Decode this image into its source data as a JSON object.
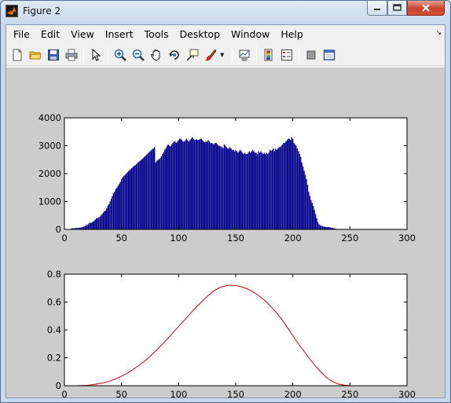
{
  "window": {
    "title": "Figure 2",
    "controls": {
      "minimize": "minimize",
      "maximize": "maximize",
      "close": "close"
    }
  },
  "menu": {
    "items": [
      "File",
      "Edit",
      "View",
      "Insert",
      "Tools",
      "Desktop",
      "Window",
      "Help"
    ]
  },
  "toolbar": {
    "buttons": [
      "new-figure",
      "open-file",
      "save-figure",
      "print-figure",
      "edit-plot",
      "zoom-in",
      "zoom-out",
      "pan",
      "rotate-3d",
      "data-cursor",
      "brush",
      "link-plot",
      "colorbar",
      "legend",
      "hide-plot-tools",
      "show-plot-tools"
    ]
  },
  "colors": {
    "histogram": "#00008b",
    "curve": "#cc0000",
    "axes_bg": "#ffffff",
    "figure_bg": "#cccccc"
  },
  "chart_data": [
    {
      "type": "bar",
      "title": "",
      "xlabel": "",
      "ylabel": "",
      "xlim": [
        0,
        300
      ],
      "ylim": [
        0,
        4000
      ],
      "xticks": [
        "0",
        "50",
        "100",
        "150",
        "200",
        "250",
        "300"
      ],
      "yticks": [
        "0",
        "1000",
        "2000",
        "3000",
        "4000"
      ],
      "bins_start": 0,
      "values": [
        0,
        0,
        0,
        0,
        0,
        10,
        30,
        40,
        40,
        40,
        50,
        50,
        50,
        60,
        60,
        70,
        80,
        100,
        120,
        150,
        160,
        190,
        230,
        240,
        240,
        280,
        300,
        350,
        400,
        410,
        430,
        450,
        500,
        550,
        600,
        650,
        680,
        750,
        850,
        900,
        1000,
        1100,
        1200,
        1300,
        1350,
        1450,
        1500,
        1560,
        1630,
        1700,
        1800,
        1860,
        1920,
        1950,
        2000,
        2040,
        2080,
        2120,
        2160,
        2200,
        2240,
        2280,
        2300,
        2340,
        2380,
        2420,
        2450,
        2480,
        2520,
        2560,
        2600,
        2640,
        2680,
        2720,
        2760,
        2800,
        2840,
        2880,
        2900,
        2950,
        2400,
        2460,
        2500,
        2520,
        2560,
        2620,
        2700,
        2780,
        2860,
        2920,
        3000,
        3050,
        3000,
        2980,
        3050,
        3100,
        3150,
        3150,
        3100,
        3150,
        3200,
        3250,
        3250,
        3200,
        3150,
        3150,
        3200,
        3250,
        3200,
        3150,
        3200,
        3250,
        3300,
        3250,
        3200,
        3220,
        3230,
        3200,
        3210,
        3250,
        3250,
        3200,
        3150,
        3120,
        3150,
        3150,
        3200,
        3150,
        3100,
        3100,
        3080,
        3050,
        3100,
        3100,
        3050,
        3000,
        3000,
        2970,
        2950,
        2920,
        3050,
        3000,
        2950,
        2900,
        2900,
        2950,
        2900,
        2850,
        2850,
        2800,
        2850,
        2800,
        2750,
        2800,
        2850,
        2800,
        2750,
        2700,
        2750,
        2700,
        2700,
        2750,
        2800,
        2750,
        2800,
        2850,
        2800,
        2750,
        2750,
        2700,
        2800,
        2750,
        2800,
        2750,
        2700,
        2750,
        2700,
        2750,
        2700,
        2750,
        2850,
        2820,
        2850,
        2900,
        2800,
        2900,
        2850,
        2900,
        2950,
        2950,
        3000,
        3050,
        3100,
        3100,
        3150,
        3200,
        3250,
        3250,
        3200,
        3300,
        3250,
        3100,
        3050,
        3000,
        2900,
        2800,
        2700,
        2600,
        2400,
        2250,
        2100,
        1950,
        1800,
        1600,
        1350,
        1200,
        1050,
        950,
        850,
        700,
        550,
        400,
        260,
        180,
        150,
        130,
        120,
        100,
        100,
        90,
        80,
        80,
        80,
        70,
        60,
        50,
        40,
        30,
        20,
        10,
        5,
        0,
        0,
        0,
        0,
        0
      ]
    },
    {
      "type": "line",
      "title": "",
      "xlabel": "",
      "ylabel": "",
      "xlim": [
        0,
        300
      ],
      "ylim": [
        0,
        0.8
      ],
      "xticks": [
        "0",
        "50",
        "100",
        "150",
        "200",
        "250",
        "300"
      ],
      "yticks": [
        "0",
        "0.2",
        "0.4",
        "0.6",
        "0.8"
      ],
      "x": [
        0,
        10,
        20,
        25,
        30,
        35,
        40,
        45,
        50,
        55,
        60,
        65,
        70,
        75,
        80,
        85,
        90,
        95,
        100,
        105,
        110,
        115,
        120,
        125,
        130,
        135,
        140,
        145,
        150,
        155,
        160,
        165,
        170,
        175,
        180,
        185,
        190,
        195,
        200,
        205,
        210,
        215,
        220,
        225,
        230,
        235,
        240,
        245,
        250,
        255
      ],
      "y": [
        0.0,
        0.0,
        0.003,
        0.008,
        0.015,
        0.022,
        0.035,
        0.05,
        0.068,
        0.09,
        0.115,
        0.145,
        0.175,
        0.21,
        0.25,
        0.29,
        0.335,
        0.38,
        0.425,
        0.47,
        0.515,
        0.56,
        0.6,
        0.64,
        0.675,
        0.7,
        0.715,
        0.722,
        0.718,
        0.71,
        0.695,
        0.675,
        0.648,
        0.615,
        0.575,
        0.53,
        0.48,
        0.42,
        0.36,
        0.3,
        0.245,
        0.19,
        0.14,
        0.095,
        0.055,
        0.03,
        0.012,
        0.004,
        0.001,
        0.0
      ]
    }
  ]
}
